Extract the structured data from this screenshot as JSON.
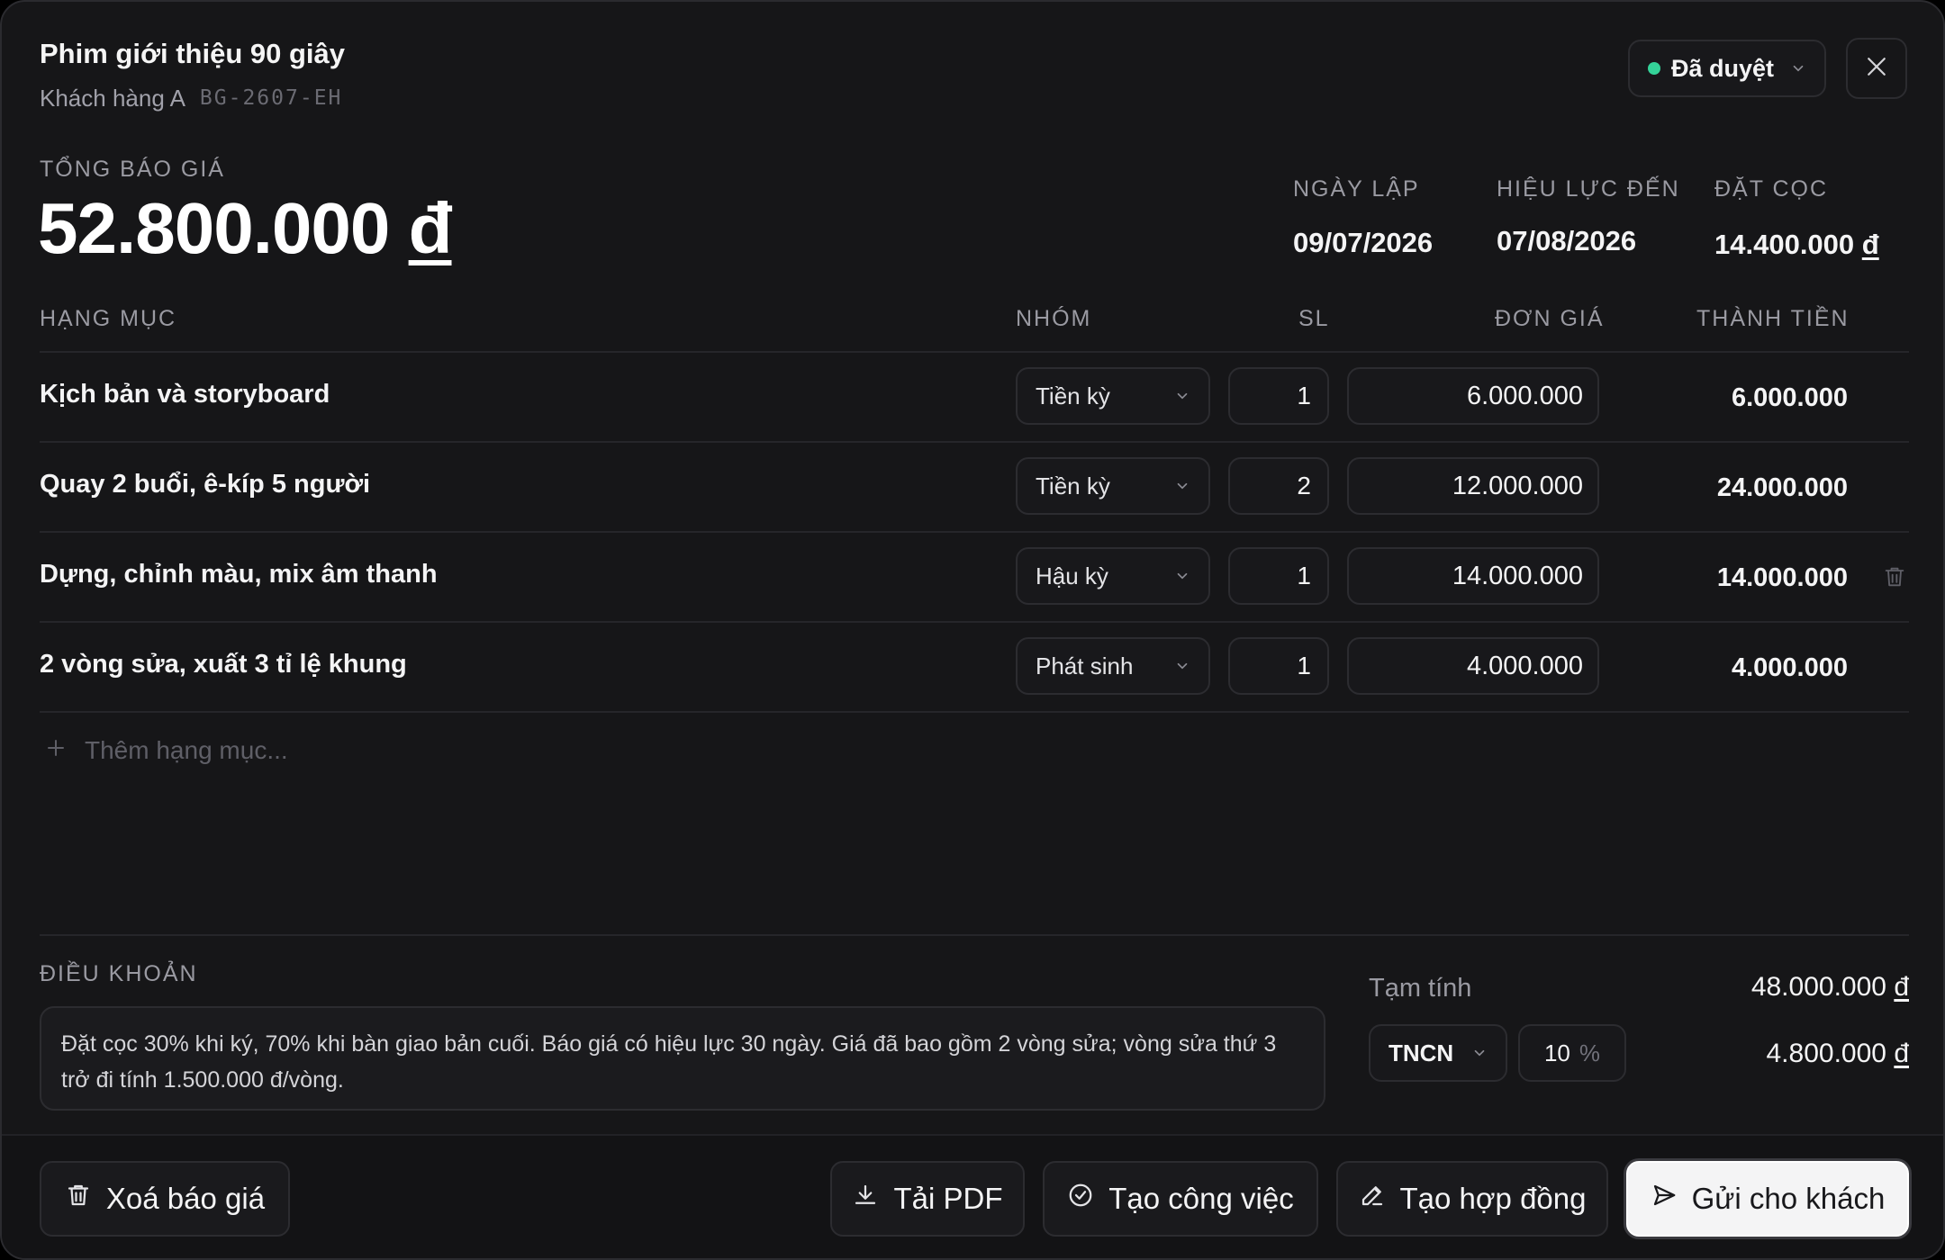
{
  "header": {
    "title": "Phim giới thiệu 90 giây",
    "client": "Khách hàng A",
    "code": "BG-2607-EH",
    "status": "Đã duyệt"
  },
  "summary": {
    "total_label": "TỔNG BÁO GIÁ",
    "total_value": "52.800.000",
    "currency": "đ",
    "issue_label": "NGÀY LẬP",
    "issue_value": "09/07/2026",
    "valid_label": "HIỆU LỰC ĐẾN",
    "valid_value": "07/08/2026",
    "deposit_label": "ĐẶT CỌC",
    "deposit_value": "14.400.000"
  },
  "table": {
    "headers": [
      "HẠNG MỤC",
      "NHÓM",
      "SL",
      "ĐƠN GIÁ",
      "THÀNH TIỀN"
    ],
    "rows": [
      {
        "name": "Kịch bản và storyboard",
        "group": "Tiền kỳ",
        "qty": "1",
        "price": "6.000.000",
        "amount": "6.000.000"
      },
      {
        "name": "Quay 2 buổi, ê-kíp 5 người",
        "group": "Tiền kỳ",
        "qty": "2",
        "price": "12.000.000",
        "amount": "24.000.000"
      },
      {
        "name": "Dựng, chỉnh màu, mix âm thanh",
        "group": "Hậu kỳ",
        "qty": "1",
        "price": "14.000.000",
        "amount": "14.000.000"
      },
      {
        "name": "2 vòng sửa, xuất 3 tỉ lệ khung",
        "group": "Phát sinh",
        "qty": "1",
        "price": "4.000.000",
        "amount": "4.000.000"
      }
    ],
    "add_placeholder": "Thêm hạng mục..."
  },
  "terms": {
    "label": "ĐIỀU KHOẢN",
    "text": "Đặt cọc 30% khi ký, 70% khi bàn giao bản cuối. Báo giá có hiệu lực 30 ngày. Giá đã bao gồm 2 vòng sửa; vòng sửa thứ 3 trở đi tính 1.500.000 đ/vòng."
  },
  "totals": {
    "subtotal_label": "Tạm tính",
    "subtotal_value": "48.000.000",
    "tax_type": "TNCN",
    "tax_rate": "10",
    "tax_unit": "%",
    "tax_value": "4.800.000",
    "currency": "đ"
  },
  "footer": {
    "delete_label": "Xoá báo giá",
    "pdf_label": "Tải PDF",
    "task_label": "Tạo công việc",
    "contract_label": "Tạo hợp đồng",
    "send_label": "Gửi cho khách"
  },
  "colors": {
    "background": "#161618",
    "status_dot": "#34d399",
    "primary_button": "#f4f4f5"
  },
  "icons": [
    "chevron-down-icon",
    "close-icon",
    "trash-icon",
    "plus-icon",
    "download-icon",
    "check-circle-icon",
    "edit-icon",
    "send-icon"
  ]
}
